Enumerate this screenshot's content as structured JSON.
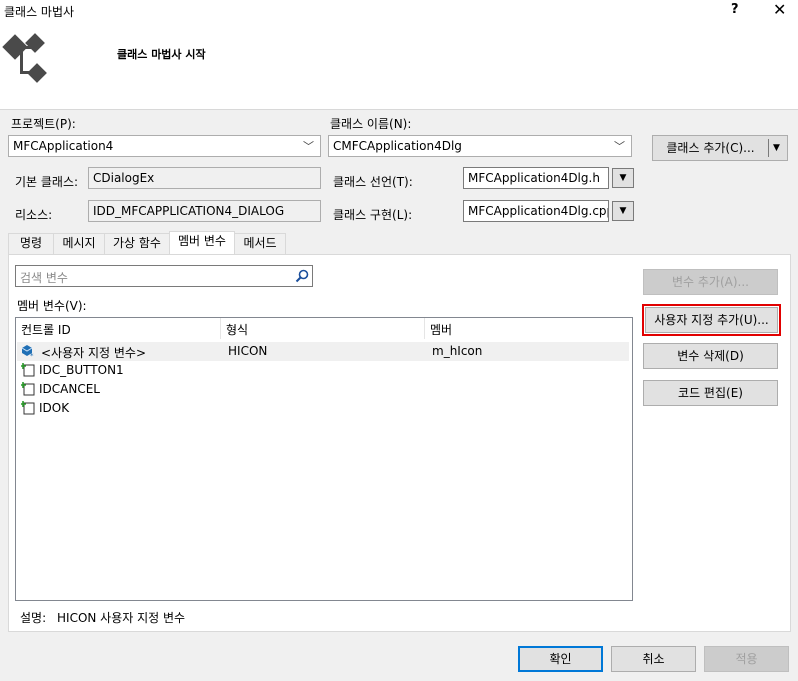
{
  "window": {
    "title": "클래스 마법사",
    "help": "?",
    "close": "✕"
  },
  "header": {
    "heading": "클래스 마법사 시작"
  },
  "project": {
    "label": "프로젝트(P):",
    "value": "MFCApplication4"
  },
  "class_name": {
    "label": "클래스 이름(N):",
    "value": "CMFCApplication4Dlg"
  },
  "add_class_button": "클래스 추가(C)...",
  "base_class": {
    "label": "기본 클래스:",
    "value": "CDialogEx"
  },
  "resource": {
    "label": "리소스:",
    "value": "IDD_MFCAPPLICATION4_DIALOG"
  },
  "class_decl": {
    "label": "클래스 선언(T):",
    "value": "MFCApplication4Dlg.h"
  },
  "class_impl": {
    "label": "클래스 구현(L):",
    "value": "MFCApplication4Dlg.cpp"
  },
  "tabs": [
    "명령",
    "메시지",
    "가상 함수",
    "멤버 변수",
    "메서드"
  ],
  "active_tab": "멤버 변수",
  "search": {
    "placeholder": "검색 변수"
  },
  "members_label": "멤버 변수(V):",
  "table": {
    "columns": [
      "컨트롤 ID",
      "형식",
      "멤버"
    ],
    "rows": [
      {
        "id": "<사용자 지정 변수>",
        "type": "HICON",
        "member": "m_hIcon",
        "icon": "custom-variable-icon"
      },
      {
        "id": "IDC_BUTTON1",
        "type": "",
        "member": "",
        "icon": "control-id-icon"
      },
      {
        "id": "IDCANCEL",
        "type": "",
        "member": "",
        "icon": "control-id-icon"
      },
      {
        "id": "IDOK",
        "type": "",
        "member": "",
        "icon": "control-id-icon"
      }
    ]
  },
  "side_buttons": {
    "add_variable": "변수 추가(A)...",
    "add_custom": "사용자 지정 추가(U)...",
    "delete_variable": "변수 삭제(D)",
    "edit_code": "코드 편집(E)"
  },
  "description": {
    "label": "설명:",
    "value": "HICON 사용자 지정 변수"
  },
  "footer": {
    "ok": "확인",
    "cancel": "취소",
    "apply": "적용"
  },
  "colors": {
    "highlight": "#e10000",
    "focus": "#0078d7"
  }
}
